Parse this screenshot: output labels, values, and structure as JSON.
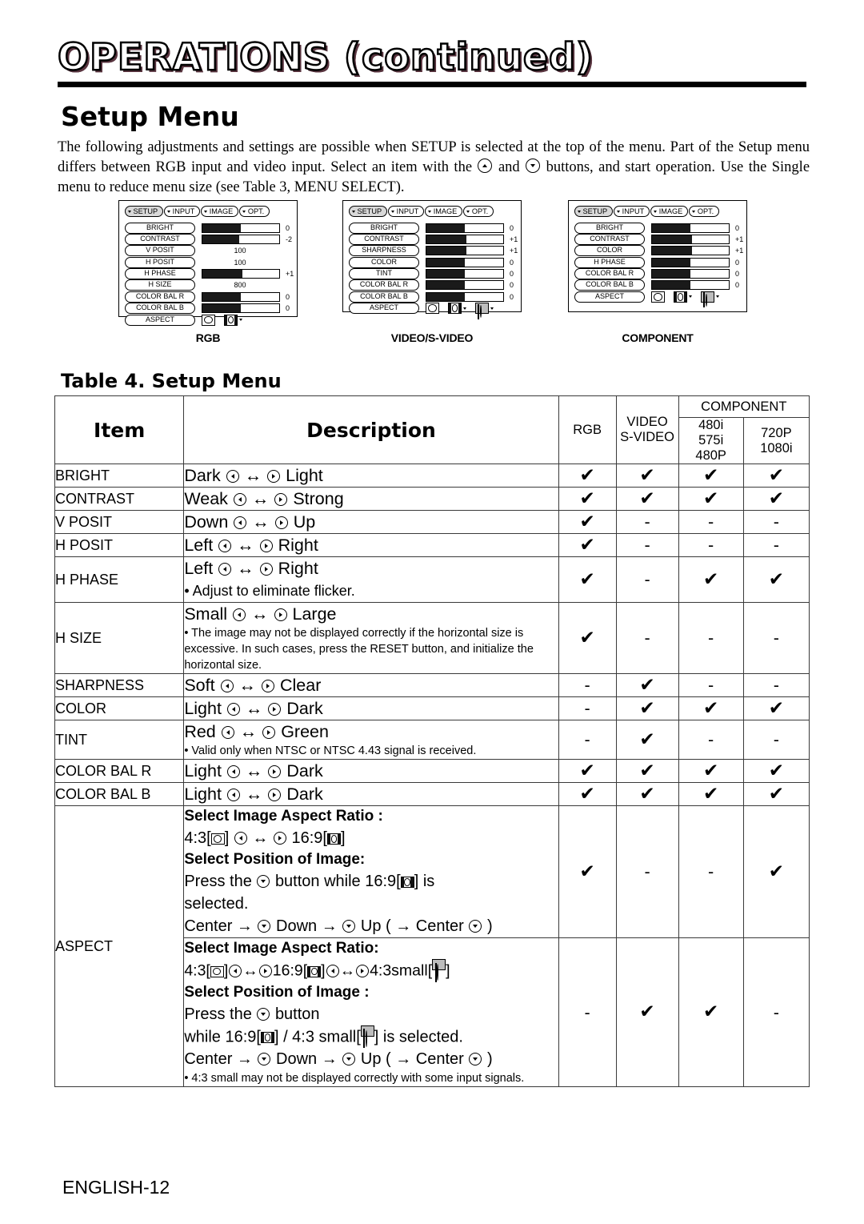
{
  "header": {
    "chapter_title": "OPERATIONS (continued)",
    "section_title": "Setup Menu",
    "intro": "The following adjustments and settings are possible when SETUP is selected at the top of the menu. Part of the Setup menu differs between RGB input and video input. Select an item with the ⓐ and ⓑ buttons, and start operation. Use the Single menu to reduce menu size (see Table 3, MENU SELECT).",
    "intro_part1": "The following adjustments and settings are possible when SETUP is selected at the top of the menu. Part of the Setup menu differs between RGB input and video input. Select an item with the",
    "intro_part2": "and",
    "intro_part3": "buttons, and start operation. Use the Single menu to reduce menu size (see Table 3, MENU SELECT)."
  },
  "osd_menus": [
    {
      "caption": "RGB",
      "tabs": [
        "SETUP",
        "INPUT",
        "IMAGE",
        "OPT."
      ],
      "selected_tab": "SETUP",
      "rows": [
        {
          "label": "BRIGHT",
          "type": "bar",
          "fill": 50,
          "value": "0"
        },
        {
          "label": "CONTRAST",
          "type": "bar",
          "fill": 48,
          "value": "-2"
        },
        {
          "label": "V POSIT",
          "type": "num",
          "value": "100"
        },
        {
          "label": "H POSIT",
          "type": "num",
          "value": "100"
        },
        {
          "label": "H PHASE",
          "type": "bar",
          "fill": 52,
          "value": "+1"
        },
        {
          "label": "H SIZE",
          "type": "num",
          "value": "800"
        },
        {
          "label": "COLOR BAL R",
          "type": "bar",
          "fill": 50,
          "value": "0"
        },
        {
          "label": "COLOR BAL B",
          "type": "bar",
          "fill": 50,
          "value": "0"
        },
        {
          "label": "ASPECT",
          "type": "icons",
          "icons": [
            "aspect-4-3",
            "aspect-16-9"
          ]
        }
      ]
    },
    {
      "caption": "VIDEO/S-VIDEO",
      "tabs": [
        "SETUP",
        "INPUT",
        "IMAGE",
        "OPT."
      ],
      "selected_tab": "SETUP",
      "rows": [
        {
          "label": "BRIGHT",
          "type": "bar",
          "fill": 50,
          "value": "0"
        },
        {
          "label": "CONTRAST",
          "type": "bar",
          "fill": 52,
          "value": "+1"
        },
        {
          "label": "SHARPNESS",
          "type": "bar",
          "fill": 52,
          "value": "+1"
        },
        {
          "label": "COLOR",
          "type": "bar",
          "fill": 50,
          "value": "0"
        },
        {
          "label": "TINT",
          "type": "bar",
          "fill": 50,
          "value": "0"
        },
        {
          "label": "COLOR BAL  R",
          "type": "bar",
          "fill": 50,
          "value": "0"
        },
        {
          "label": "COLOR BAL  B",
          "type": "bar",
          "fill": 50,
          "value": "0"
        },
        {
          "label": "ASPECT",
          "type": "icons",
          "icons": [
            "aspect-4-3",
            "aspect-16-9",
            "aspect-4-3-small"
          ]
        }
      ]
    },
    {
      "caption": "COMPONENT",
      "tabs": [
        "SETUP",
        "INPUT",
        "IMAGE",
        "OPT."
      ],
      "selected_tab": "SETUP",
      "rows": [
        {
          "label": "BRIGHT",
          "type": "bar",
          "fill": 50,
          "value": "0"
        },
        {
          "label": "CONTRAST",
          "type": "bar",
          "fill": 52,
          "value": "+1"
        },
        {
          "label": "COLOR",
          "type": "bar",
          "fill": 52,
          "value": "+1"
        },
        {
          "label": "H PHASE",
          "type": "bar",
          "fill": 50,
          "value": "0"
        },
        {
          "label": "COLOR BAL  R",
          "type": "bar",
          "fill": 50,
          "value": "0"
        },
        {
          "label": "COLOR BAL  B",
          "type": "bar",
          "fill": 50,
          "value": "0"
        },
        {
          "label": "ASPECT",
          "type": "icons",
          "icons": [
            "aspect-4-3",
            "aspect-16-9",
            "aspect-4-3-small"
          ]
        }
      ]
    }
  ],
  "table": {
    "title": "Table 4. Setup Menu",
    "headers": {
      "item": "Item",
      "description": "Description",
      "rgb": "RGB",
      "video_line1": "VIDEO",
      "video_line2": "S-VIDEO",
      "component": "COMPONENT",
      "comp1_line1": "480i",
      "comp1_line2": "575i",
      "comp1_line3": "480P",
      "comp2_line1": "720P",
      "comp2_line2": "1080i"
    },
    "marks": {
      "check": "✔",
      "dash": "-"
    },
    "rows": [
      {
        "item": "BRIGHT",
        "desc_left": "Dark",
        "desc_right": "Light",
        "support": [
          "check",
          "check",
          "check",
          "check"
        ]
      },
      {
        "item": "CONTRAST",
        "desc_left": "Weak",
        "desc_right": "Strong",
        "support": [
          "check",
          "check",
          "check",
          "check"
        ]
      },
      {
        "item": "V POSIT",
        "desc_left": "Down",
        "desc_right": "Up",
        "support": [
          "check",
          "dash",
          "dash",
          "dash"
        ]
      },
      {
        "item": "H POSIT",
        "desc_left": "Left",
        "desc_right": "Right",
        "support": [
          "check",
          "dash",
          "dash",
          "dash"
        ]
      },
      {
        "item": "H PHASE",
        "desc_left": "Left",
        "desc_right": "Right",
        "note": "• Adjust to eliminate flicker.",
        "support": [
          "check",
          "dash",
          "check",
          "check"
        ]
      },
      {
        "item": "H SIZE",
        "desc_left": "Small",
        "desc_right": "Large",
        "note": "• The image may not be displayed correctly if the horizontal size is excessive. In such cases, press the RESET button, and initialize the horizontal size.",
        "support": [
          "check",
          "dash",
          "dash",
          "dash"
        ]
      },
      {
        "item": "SHARPNESS",
        "desc_left": "Soft",
        "desc_right": "Clear",
        "support": [
          "dash",
          "check",
          "dash",
          "dash"
        ]
      },
      {
        "item": "COLOR",
        "desc_left": "Light",
        "desc_right": "Dark",
        "support": [
          "dash",
          "check",
          "check",
          "check"
        ]
      },
      {
        "item": "TINT",
        "desc_left": "Red",
        "desc_right": "Green",
        "note": "• Valid only when NTSC or NTSC 4.43 signal is received.",
        "support": [
          "dash",
          "check",
          "dash",
          "dash"
        ]
      },
      {
        "item": "COLOR BAL R",
        "desc_left": "Light",
        "desc_right": "Dark",
        "support": [
          "check",
          "check",
          "check",
          "check"
        ]
      },
      {
        "item": "COLOR BAL B",
        "desc_left": "Light",
        "desc_right": "Dark",
        "support": [
          "check",
          "check",
          "check",
          "check"
        ]
      }
    ],
    "aspect": {
      "item": "ASPECT",
      "block1": {
        "heading1": "Select Image Aspect Ratio :",
        "ratio_43": "4:3[",
        "ratio_43_close": "]",
        "ratio_169": "16:9[",
        "ratio_169_close": "]",
        "heading2": "Select Position of Image:",
        "press_pre": "Press the",
        "press_mid": "button while 16:9[",
        "press_post": "] is",
        "press_cont": "selected.",
        "sequence_center": "Center →",
        "sequence_down": "Down →",
        "sequence_up": "Up ( → Center",
        "sequence_end": ")",
        "support": [
          "check",
          "dash",
          "dash",
          "check"
        ]
      },
      "block2": {
        "heading1": "Select Image Aspect Ratio:",
        "ratio_43": "4:3[",
        "ratio_169": "16:9[",
        "ratio_43small": "4:3small[",
        "close": "]",
        "heading2": "Select Position of Image :",
        "press_pre": "Press the",
        "press_post": "button",
        "while_pre": "while 16:9[",
        "while_mid": "] / 4:3 small[",
        "while_post": "] is selected.",
        "sequence_center": "Center →",
        "sequence_down": "Down →",
        "sequence_up": "Up ( → Center",
        "sequence_end": ")",
        "note": "• 4:3 small may not be displayed correctly with some input signals.",
        "support": [
          "dash",
          "check",
          "check",
          "dash"
        ]
      }
    }
  },
  "footer": {
    "page_label": "ENGLISH-12"
  }
}
